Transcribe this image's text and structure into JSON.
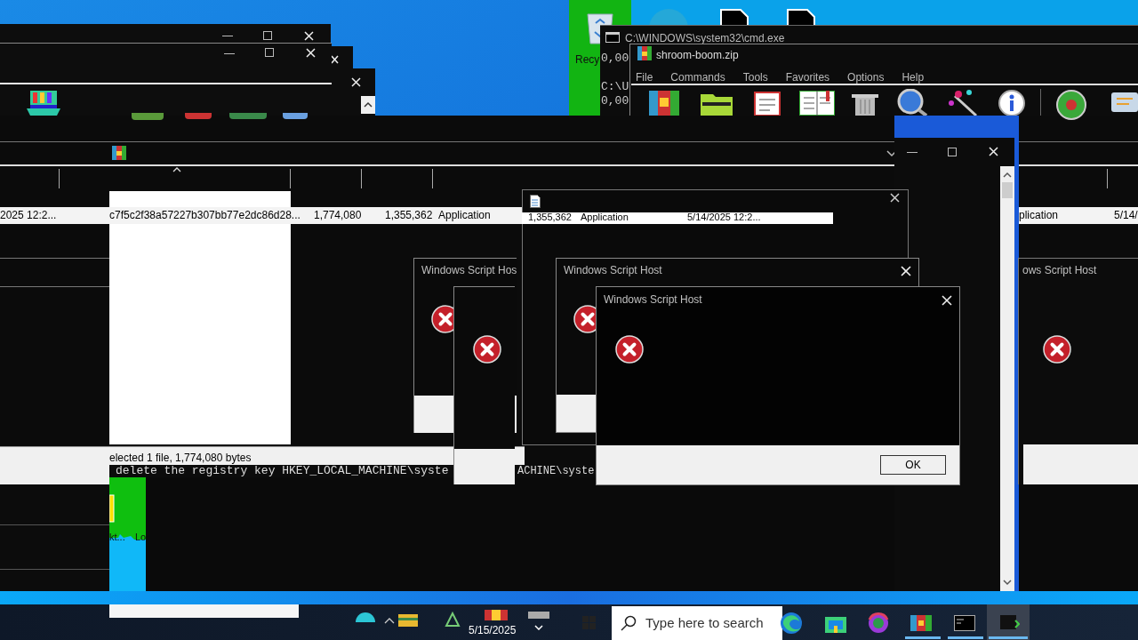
{
  "desktop": {
    "icon_label": "Recy"
  },
  "file_list": {
    "row": [
      "2025 12:2...",
      "c7f5c2f38a57227b307bb77e2dc86d28...",
      "1,774,080",
      "1,355,362",
      "Application"
    ],
    "row_right": [
      "plication",
      "5/14/"
    ],
    "status": "elected 1 file, 1,774,080 bytes",
    "side_labels": [
      "kt...",
      "Lo"
    ]
  },
  "cmd": {
    "title": "C:\\WINDOWS\\system32\\cmd.exe",
    "lines": [
      "0,00",
      "C:\\U",
      "0,00"
    ],
    "message": [
      "delete the registry key HKEY_LOCAL_MACHINE\\syste",
      "ACHINE\\syste"
    ]
  },
  "archive_window": {
    "title": "shroom-boom.zip",
    "menu": [
      "File",
      "Commands",
      "Tools",
      "Favorites",
      "Options",
      "Help"
    ]
  },
  "document_window": {
    "row": [
      "1,355,362",
      "Application",
      "5/14/2025 12:2..."
    ]
  },
  "dialogs": [
    {
      "kind": "error",
      "title": "Windows Script Hos"
    },
    {
      "kind": "error"
    },
    {
      "kind": "error",
      "title": "Windows Script Host"
    },
    {
      "kind": "error",
      "title": "Windows Script Host",
      "button": "OK"
    },
    {
      "kind": "error",
      "title": "ows Script Host"
    }
  ],
  "taskbar": {
    "search": {
      "placeholder": "Type here to search"
    },
    "date": "5/15/2025"
  }
}
